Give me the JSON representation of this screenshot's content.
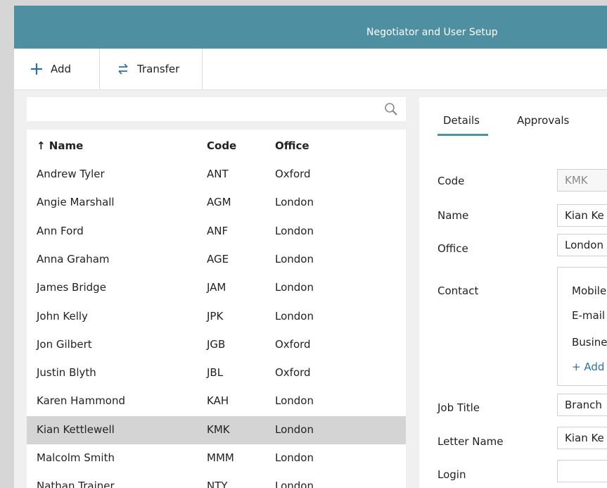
{
  "window": {
    "title": "Negotiator and User Setup"
  },
  "toolbar": {
    "add_label": "Add",
    "transfer_label": "Transfer"
  },
  "search": {
    "placeholder": "",
    "value": ""
  },
  "list": {
    "columns": {
      "name": "↑ Name",
      "code": "Code",
      "office": "Office"
    },
    "sort": "name ascending",
    "rows": [
      {
        "name": "Andrew Tyler",
        "code": "ANT",
        "office": "Oxford"
      },
      {
        "name": "Angie Marshall",
        "code": "AGM",
        "office": "London"
      },
      {
        "name": "Ann Ford",
        "code": "ANF",
        "office": "London"
      },
      {
        "name": "Anna Graham",
        "code": "AGE",
        "office": "London"
      },
      {
        "name": "James Bridge",
        "code": "JAM",
        "office": "London"
      },
      {
        "name": "John Kelly",
        "code": "JPK",
        "office": "London"
      },
      {
        "name": "Jon Gilbert",
        "code": "JGB",
        "office": "Oxford"
      },
      {
        "name": "Justin Blyth",
        "code": "JBL",
        "office": "Oxford"
      },
      {
        "name": "Karen Hammond",
        "code": "KAH",
        "office": "London"
      },
      {
        "name": "Kian Kettlewell",
        "code": "KMK",
        "office": "London",
        "selected": true
      },
      {
        "name": "Malcolm Smith",
        "code": "MMM",
        "office": "London"
      },
      {
        "name": "Nathan Trainer",
        "code": "NTY",
        "office": "London"
      }
    ]
  },
  "detail": {
    "tabs": [
      {
        "label": "Details",
        "active": true
      },
      {
        "label": "Approvals"
      }
    ],
    "labels": {
      "code": "Code",
      "name": "Name",
      "office": "Office",
      "contact": "Contact",
      "job_title": "Job Title",
      "letter_name": "Letter Name",
      "login": "Login"
    },
    "values": {
      "code": "KMK",
      "name": "Kian Ke",
      "office": "London",
      "job_title": "Branch",
      "letter_name": "Kian Ke",
      "login": ""
    },
    "contact_items": [
      "Mobile",
      "E-mail",
      "Busine"
    ],
    "add_contact_label": "Add"
  },
  "colors": {
    "header": "#4e8fa1",
    "selected_row": "#d4d4d4",
    "link": "#2f6fa8"
  }
}
